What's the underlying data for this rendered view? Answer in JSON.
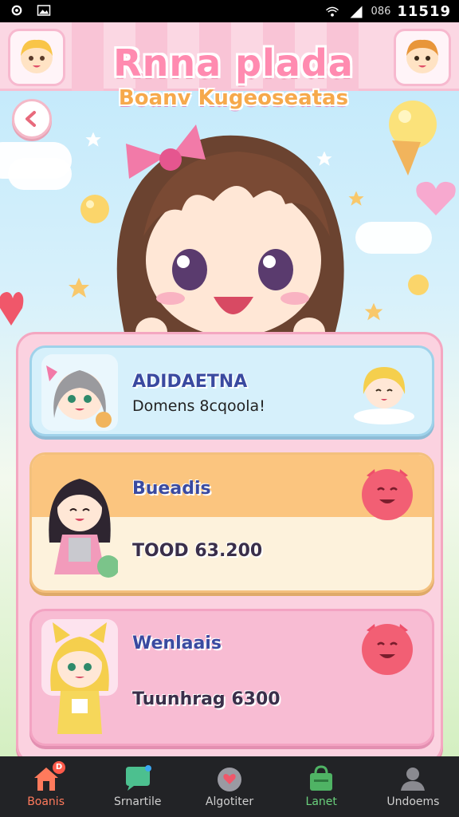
{
  "status_bar": {
    "battery_text": "086",
    "time": "11519"
  },
  "header": {
    "title": "Rnna plada",
    "subtitle": "Boanv Kugeoseatas"
  },
  "cards": [
    {
      "title": "ADIDAETNA",
      "line": "Domens 8cqoola!"
    },
    {
      "title": "Bueadis",
      "value": "TOOD 63.200"
    },
    {
      "title": "Wenlaais",
      "value": "Tuunhrag 6300"
    }
  ],
  "tabs": [
    {
      "label": "Boanis",
      "badge": "D"
    },
    {
      "label": "Srnartile"
    },
    {
      "label": "Algotiter"
    },
    {
      "label": "Lanet"
    },
    {
      "label": "Undoems"
    }
  ],
  "colors": {
    "accent_pink": "#ff8bb0",
    "active_tab": "#ff7a5c",
    "green_tab": "#6ad07c",
    "panel_pink": "#fbd2e0"
  }
}
